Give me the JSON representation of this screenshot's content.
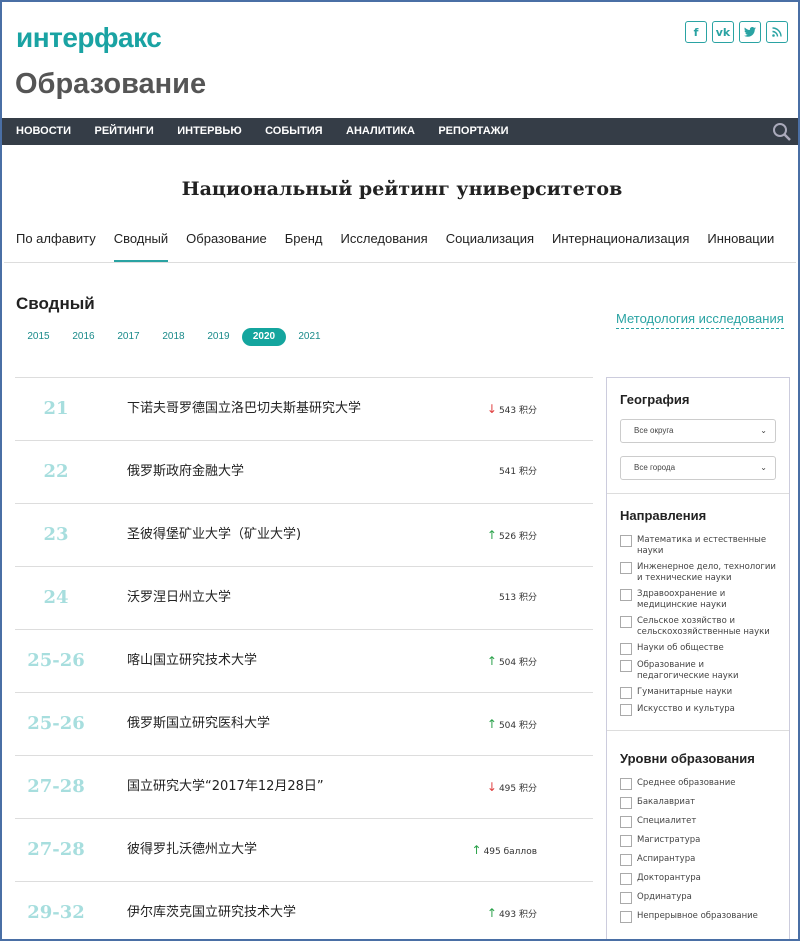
{
  "header": {
    "logo_text": "интерфакс",
    "section_title": "Образование",
    "socials": [
      {
        "name": "facebook-icon",
        "glyph": "f"
      },
      {
        "name": "vk-icon",
        "glyph": "vk"
      },
      {
        "name": "twitter-icon",
        "glyph": "t"
      },
      {
        "name": "rss-icon",
        "glyph": "≋"
      }
    ]
  },
  "nav": {
    "items": [
      "НОВОСТИ",
      "РЕЙТИНГИ",
      "ИНТЕРВЬЮ",
      "СОБЫТИЯ",
      "АНАЛИТИКА",
      "РЕПОРТАЖИ"
    ],
    "search_icon": "search-icon"
  },
  "page": {
    "heading": "Национальный рейтинг университетов",
    "tabs": [
      "По алфавиту",
      "Сводный",
      "Образование",
      "Бренд",
      "Исследования",
      "Социализация",
      "Интернационализация",
      "Инновации"
    ],
    "active_tab": "Сводный",
    "sub_title": "Сводный",
    "years": [
      "2015",
      "2016",
      "2017",
      "2018",
      "2019",
      "2020",
      "2021"
    ],
    "active_year": "2020",
    "methodology_link": "Методология исследования"
  },
  "rows": [
    {
      "rank": "21",
      "name": "下诺夫哥罗德国立洛巴切夫斯基研究大学",
      "score": "543 积分",
      "trend": "down"
    },
    {
      "rank": "22",
      "name": "俄罗斯政府金融大学",
      "score": "541 积分",
      "trend": "none"
    },
    {
      "rank": "23",
      "name": "圣彼得堡矿业大学（矿业大学)",
      "score": "526 积分",
      "trend": "up"
    },
    {
      "rank": "24",
      "name": "沃罗涅日州立大学",
      "score": "513 积分",
      "trend": "none"
    },
    {
      "rank": "25-26",
      "name": "喀山国立研究技术大学",
      "score": "504 积分",
      "trend": "up"
    },
    {
      "rank": "25-26",
      "name": "俄罗斯国立研究医科大学",
      "score": "504 积分",
      "trend": "up"
    },
    {
      "rank": "27-28",
      "name": "国立研究大学“2017年12月28日”",
      "score": "495 积分",
      "trend": "down"
    },
    {
      "rank": "27-28",
      "name": "彼得罗扎沃德州立大学",
      "score": "495 баллов",
      "trend": "up"
    },
    {
      "rank": "29-32",
      "name": "伊尔库茨克国立研究技术大学",
      "score": "493 积分",
      "trend": "up"
    }
  ],
  "sidebar": {
    "geo_title": "География",
    "district_select": "Все округа",
    "city_select": "Все города",
    "directions_title": "Направления",
    "directions": [
      "Математика и естественные науки",
      "Инженерное дело, технологии и технические науки",
      "Здравоохранение и медицинские науки",
      "Сельское хозяйство и сельскохозяйственные науки",
      "Науки об обществе",
      "Образование и педагогические науки",
      "Гуманитарные науки",
      "Искусство и культура"
    ],
    "levels_title": "Уровни образования",
    "levels": [
      "Среднее образование",
      "Бакалавриат",
      "Специалитет",
      "Магистратура",
      "Аспирантура",
      "Докторантура",
      "Ординатура",
      "Непрерывное образование"
    ]
  },
  "colors": {
    "accent": "#14a59e",
    "nav_bg": "#353d47",
    "rank": "#a7dede",
    "up": "#2aa14a",
    "down": "#e04040"
  }
}
